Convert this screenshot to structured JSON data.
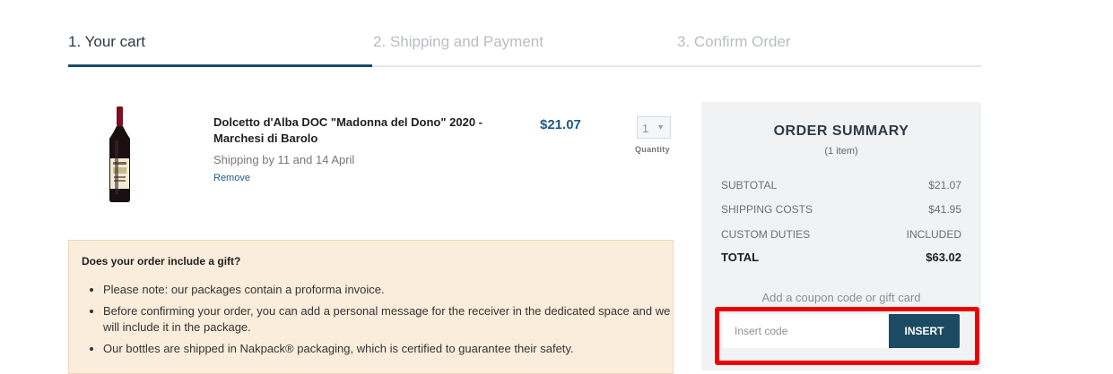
{
  "steps": [
    {
      "label": "1. Your cart"
    },
    {
      "label": "2. Shipping and Payment"
    },
    {
      "label": "3. Confirm Order"
    }
  ],
  "cart": {
    "item": {
      "name": "Dolcetto d'Alba DOC \"Madonna del Dono\" 2020 - Marchesi di Barolo",
      "shipping": "Shipping by 11 and 14 April",
      "remove_label": "Remove",
      "price": "$21.07",
      "quantity": "1",
      "quantity_label": "Quantity"
    }
  },
  "gift": {
    "title": "Does your order include a gift?",
    "bullets": [
      "Please note: our packages contain a proforma invoice.",
      "Before confirming your order, you can add a personal message for the receiver in the dedicated space and we will include it in the package.",
      "Our bottles are shipped in Nakpack® packaging, which is certified to guarantee their safety."
    ]
  },
  "summary": {
    "title": "ORDER SUMMARY",
    "items_count": "(1 item)",
    "rows": [
      {
        "label": "SUBTOTAL",
        "value": "$21.07"
      },
      {
        "label": "SHIPPING COSTS",
        "value": "$41.95"
      },
      {
        "label": "CUSTOM DUTIES",
        "value": "INCLUDED"
      },
      {
        "label": "TOTAL",
        "value": "$63.02"
      }
    ],
    "coupon_label": "Add a coupon code or gift card",
    "coupon_placeholder": "Insert code",
    "coupon_button": "INSERT"
  },
  "colors": {
    "accent": "#1d4a68",
    "price": "#1f5a86",
    "highlight": "#ee0000",
    "gift_bg": "#fbeddb"
  }
}
